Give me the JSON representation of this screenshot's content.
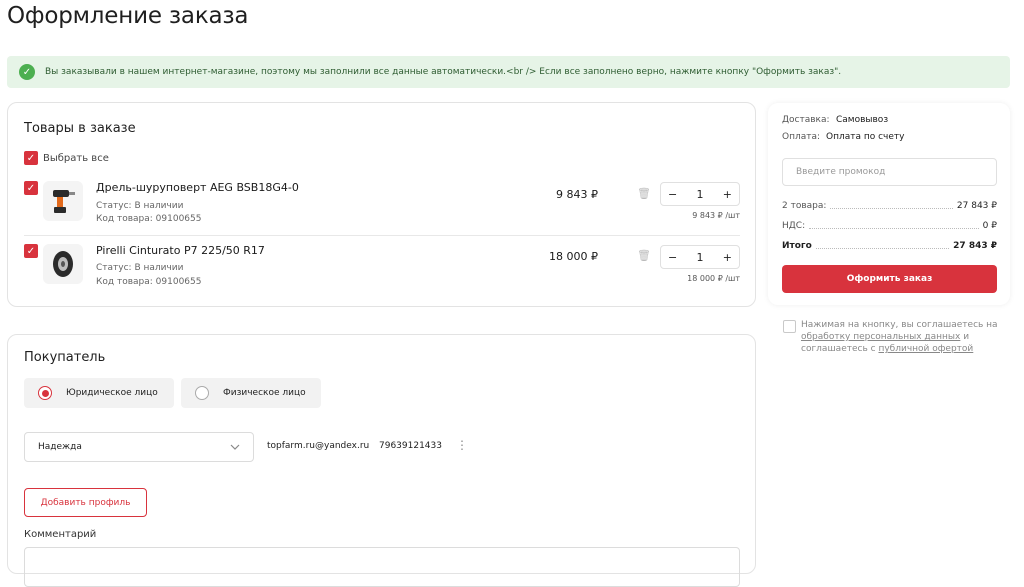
{
  "page": {
    "title": "Оформление заказа"
  },
  "alert": {
    "text": "Вы заказывали в нашем интернет-магазине, поэтому мы заполнили все данные автоматически.<br /> Если все заполнено верно, нажмите кнопку \"Оформить заказ\"."
  },
  "cart": {
    "title": "Товары в заказе",
    "select_all": "Выбрать все",
    "items": [
      {
        "name": "Дрель-шуруповерт AEG BSB18G4-0",
        "status": "Статус: В наличии",
        "code": "Код товара: 09100655",
        "price": "9 843 ₽",
        "qty": "1",
        "unit_price": "9 843 ₽ /шт"
      },
      {
        "name": "Pirelli Cinturato P7 225/50 R17",
        "status": "Статус: В наличии",
        "code": "Код товара: 09100655",
        "price": "18 000 ₽",
        "qty": "1",
        "unit_price": "18 000 ₽ /шт"
      }
    ],
    "minus": "−",
    "plus": "+"
  },
  "summary": {
    "delivery_label": "Доставка:",
    "delivery_value": "Самовывоз",
    "payment_label": "Оплата:",
    "payment_value": "Оплата по счету",
    "promo_placeholder": "Введите промокод",
    "goods_label": "2 товара:",
    "goods_value": "27 843 ₽",
    "vat_label": "НДС:",
    "vat_value": "0 ₽",
    "total_label": "Итого",
    "total_value": "27 843 ₽",
    "order_button": "Оформить заказ"
  },
  "agreement": {
    "text1": "Нажимая на кнопку, вы соглашаетесь на",
    "link1": "обработку персональных данных",
    "text2": " и соглашаетесь с ",
    "link2": "публичной офертой"
  },
  "buyer": {
    "title": "Покупатель",
    "type_legal": "Юридическое лицо",
    "type_person": "Физическое лицо",
    "profile": "Надежда",
    "email": "topfarm.ru@yandex.ru",
    "phone": "79639121433",
    "add_profile": "Добавить профиль",
    "comment_label": "Комментарий"
  }
}
